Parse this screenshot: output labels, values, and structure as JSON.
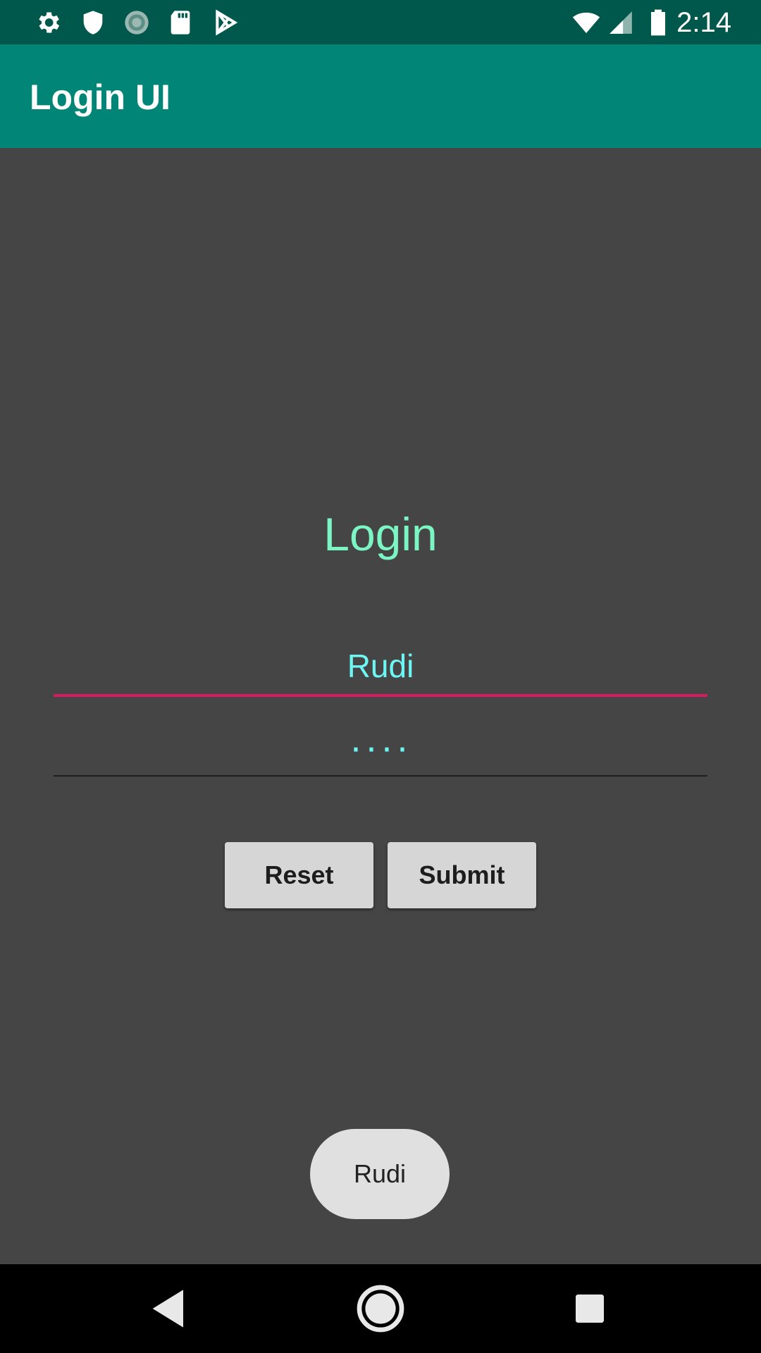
{
  "status_bar": {
    "time": "2:14",
    "left_icons": [
      "gear-icon",
      "shield-icon",
      "sync-icon",
      "sd-card-icon",
      "play-store-icon"
    ],
    "right_icons": [
      "wifi-icon",
      "signal-icon",
      "battery-icon"
    ]
  },
  "app_bar": {
    "title": "Login UI"
  },
  "form": {
    "heading": "Login",
    "username_value": "Rudi",
    "password_value": "····"
  },
  "buttons": {
    "reset_label": "Reset",
    "submit_label": "Submit"
  },
  "toast": {
    "text": "Rudi"
  },
  "nav_bar": {
    "buttons": [
      "back-icon",
      "home-icon",
      "recents-icon"
    ]
  },
  "colors": {
    "status_bar": "#00574b",
    "app_bar": "#008577",
    "background": "#454545",
    "heading": "#7cf5c4",
    "input_text": "#6ef7f2",
    "input_focus_line": "#d81b60",
    "button_bg": "#d6d6d6"
  }
}
